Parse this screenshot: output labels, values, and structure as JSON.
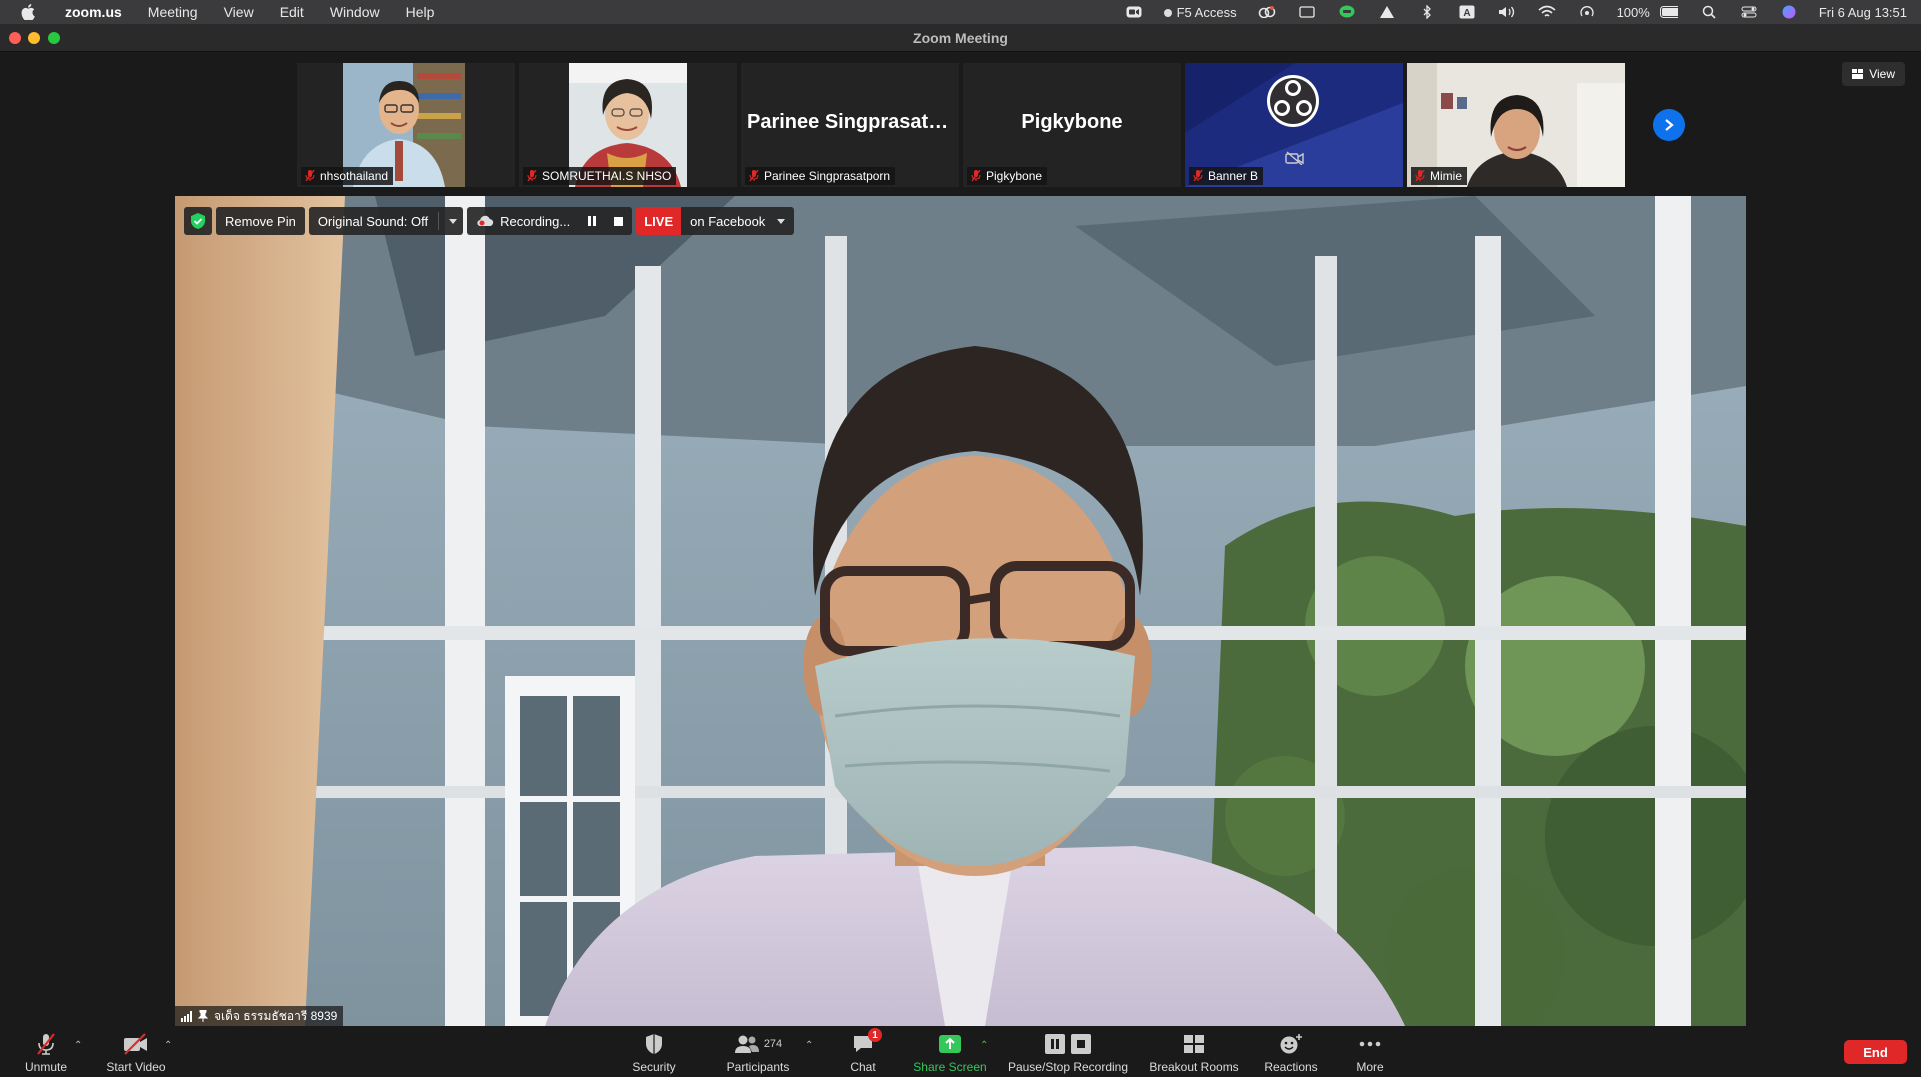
{
  "menubar": {
    "app_name": "zoom.us",
    "menus": [
      "Meeting",
      "View",
      "Edit",
      "Window",
      "Help"
    ],
    "status_f5": "F5 Access",
    "battery": "100%",
    "datetime": "Fri 6 Aug  13:51"
  },
  "window": {
    "title": "Zoom Meeting"
  },
  "view_button": "View",
  "participants_strip": [
    {
      "name": "nhsothailand",
      "has_video": true
    },
    {
      "name": "SOMRUETHAI.S NHSO",
      "has_video": true
    },
    {
      "name": "Parinee Singprasatporn",
      "big_name": "Parinee Singprasatp...",
      "has_video": false
    },
    {
      "name": "Pigkybone",
      "big_name": "Pigkybone",
      "has_video": false
    },
    {
      "name": "Banner B",
      "has_video": true,
      "video_off_icon": true
    },
    {
      "name": "Mimie",
      "has_video": true
    }
  ],
  "video_controls": {
    "remove_pin": "Remove Pin",
    "original_sound": "Original Sound: Off",
    "recording": "Recording...",
    "live_badge": "LIVE",
    "live_target": "on Facebook"
  },
  "active_speaker": {
    "name": "จเด็จ ธรรมธัชอารี 8939"
  },
  "toolbar": {
    "unmute": "Unmute",
    "start_video": "Start Video",
    "security": "Security",
    "participants": "Participants",
    "participants_count": "274",
    "chat": "Chat",
    "chat_badge": "1",
    "share_screen": "Share Screen",
    "pause_stop_recording": "Pause/Stop Recording",
    "breakout_rooms": "Breakout Rooms",
    "reactions": "Reactions",
    "more": "More",
    "end": "End"
  },
  "colors": {
    "accent_blue": "#0e72ed",
    "live_red": "#e02828",
    "share_green": "#34c759"
  }
}
